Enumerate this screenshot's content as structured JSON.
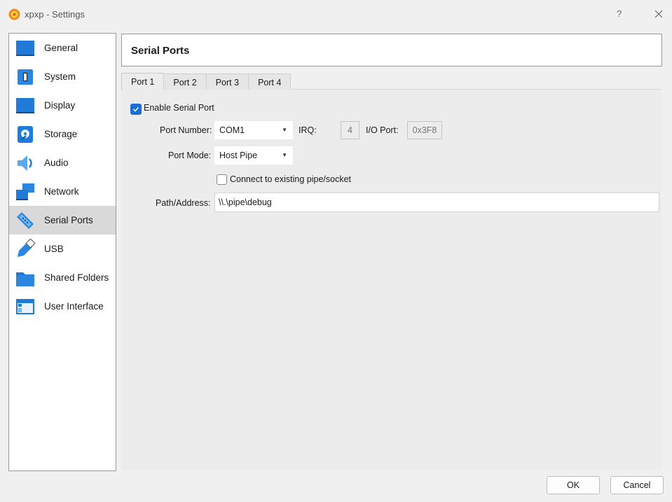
{
  "window": {
    "title": "xpxp - Settings",
    "help_label": "?"
  },
  "sidebar": {
    "items": [
      {
        "label": "General",
        "icon": "general-icon"
      },
      {
        "label": "System",
        "icon": "system-icon"
      },
      {
        "label": "Display",
        "icon": "display-icon"
      },
      {
        "label": "Storage",
        "icon": "storage-icon"
      },
      {
        "label": "Audio",
        "icon": "audio-icon"
      },
      {
        "label": "Network",
        "icon": "network-icon"
      },
      {
        "label": "Serial Ports",
        "icon": "serial-ports-icon",
        "selected": true
      },
      {
        "label": "USB",
        "icon": "usb-icon"
      },
      {
        "label": "Shared Folders",
        "icon": "shared-folders-icon"
      },
      {
        "label": "User Interface",
        "icon": "user-interface-icon"
      }
    ]
  },
  "page": {
    "title": "Serial Ports"
  },
  "tabs": [
    {
      "label": "Port 1",
      "active": true
    },
    {
      "label": "Port 2"
    },
    {
      "label": "Port 3"
    },
    {
      "label": "Port 4"
    }
  ],
  "form": {
    "enable_serial_port": {
      "label": "Enable Serial Port",
      "checked": true
    },
    "port_number": {
      "label": "Port Number:",
      "value": "COM1"
    },
    "irq": {
      "label": "IRQ:",
      "value": "4"
    },
    "io_port": {
      "label": "I/O Port:",
      "value": "0x3F8"
    },
    "port_mode": {
      "label": "Port Mode:",
      "value": "Host Pipe"
    },
    "connect_existing": {
      "label": "Connect to existing pipe/socket",
      "checked": false
    },
    "path_address": {
      "label": "Path/Address:",
      "value": "\\\\.\\pipe\\debug"
    }
  },
  "buttons": {
    "ok": "OK",
    "cancel": "Cancel"
  },
  "colors": {
    "accent": "#1c6fd1",
    "selected_item": "#d9d9d9",
    "icon_blue": "#1f7ad8"
  }
}
